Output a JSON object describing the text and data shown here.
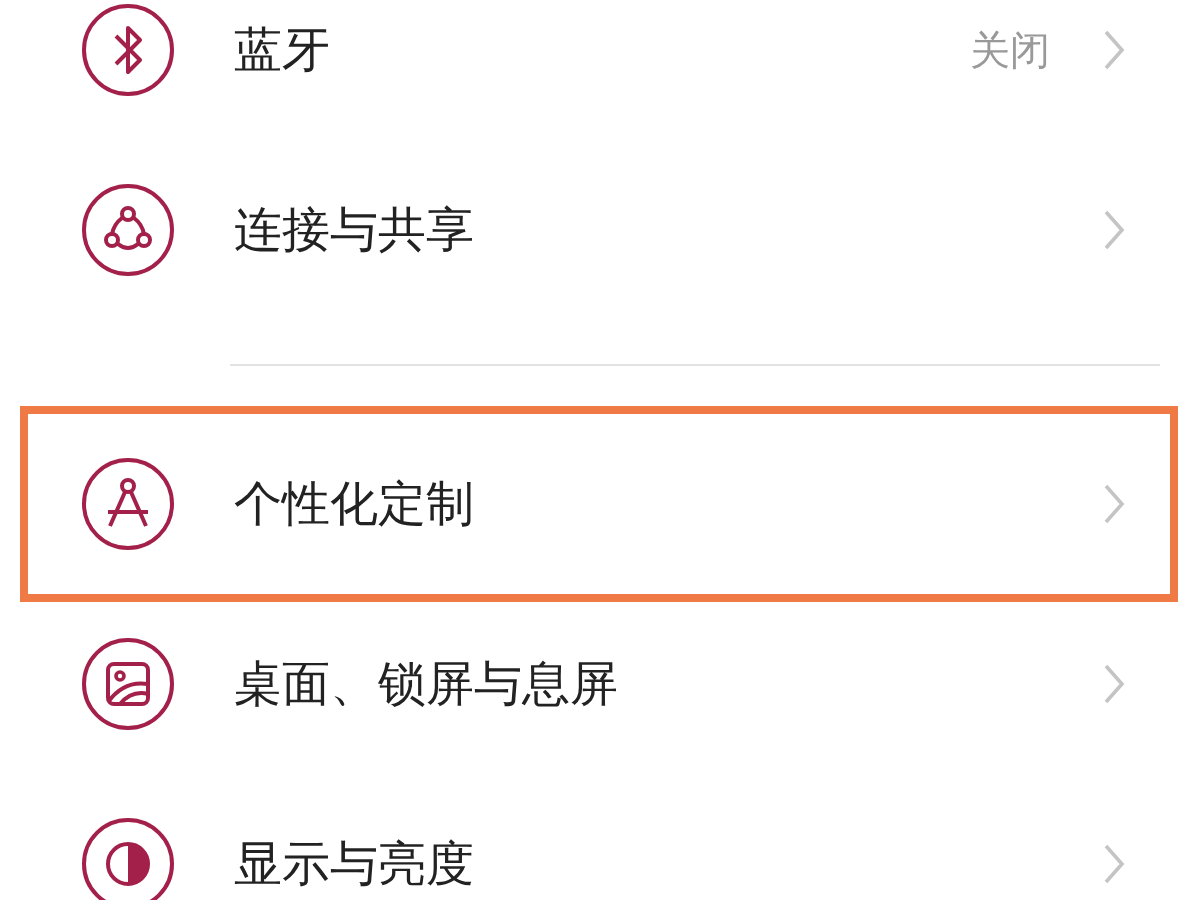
{
  "groups": [
    {
      "items": [
        {
          "kind": "bluetooth",
          "label": "蓝牙",
          "value": "关闭",
          "highlighted": false
        },
        {
          "kind": "share",
          "label": "连接与共享",
          "highlighted": false
        }
      ]
    },
    {
      "items": [
        {
          "kind": "compass",
          "label": "个性化定制",
          "highlighted": true
        },
        {
          "kind": "wallpaper",
          "label": "桌面、锁屏与息屏",
          "highlighted": false
        },
        {
          "kind": "contrast",
          "label": "显示与亮度",
          "highlighted": false
        }
      ]
    }
  ]
}
